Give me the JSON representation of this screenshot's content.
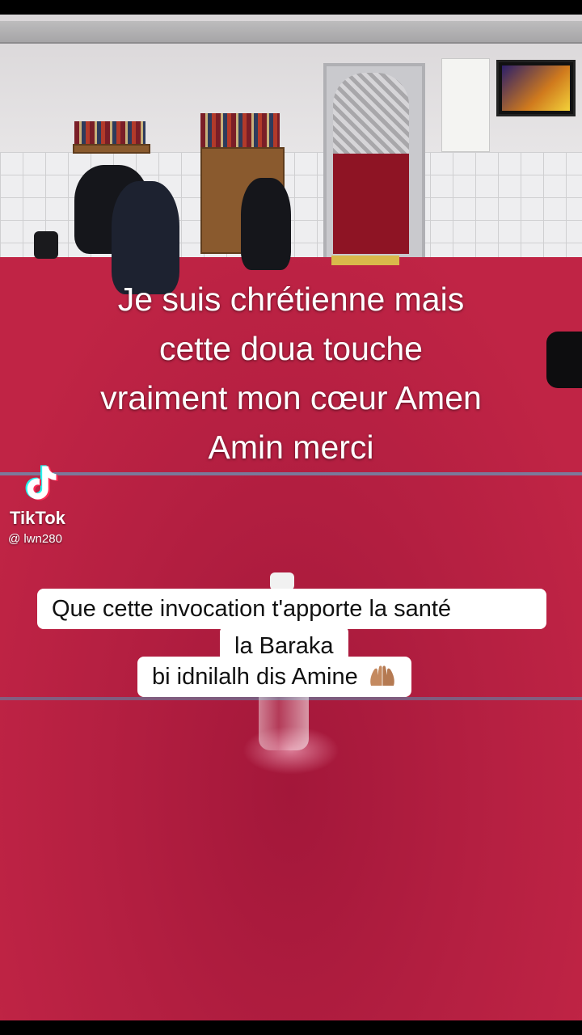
{
  "overlay": {
    "line1": "Je suis chrétienne mais",
    "line2": "cette doua touche",
    "line3": "vraiment mon cœur Amen",
    "line4": "Amin merci"
  },
  "watermark": {
    "brand": "TikTok",
    "username": "@ lwn280"
  },
  "caption": {
    "line1": "Que cette invocation t'apporte la santé",
    "line2": "la Baraka",
    "line3": "bi idnilalh dis Amine"
  },
  "colors": {
    "carpet": "#b8203f",
    "caption_bg": "#ffffff",
    "text": "#ffffff"
  },
  "icons": [
    "tiktok-logo-icon",
    "praying-hands-icon"
  ]
}
